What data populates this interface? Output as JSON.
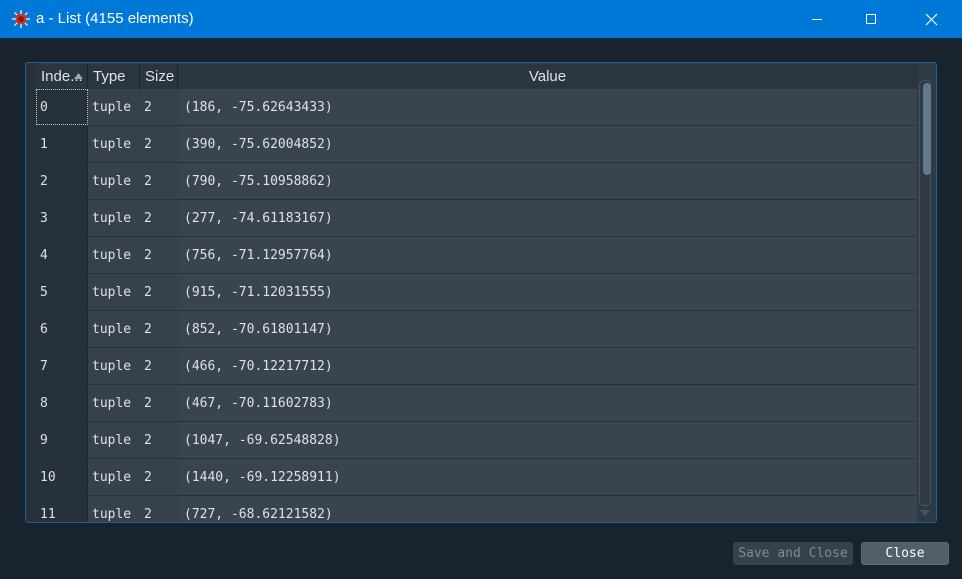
{
  "window": {
    "title": "a - List (4155 elements)",
    "accent_color": "#0078d7",
    "icon": "spyder-icon"
  },
  "table": {
    "columns": [
      "Inde...",
      "Type",
      "Size",
      "Value"
    ],
    "sort_column": "Inde...",
    "rows": [
      {
        "index": "0",
        "type": "tuple",
        "size": "2",
        "value": "(186, -75.62643433)"
      },
      {
        "index": "1",
        "type": "tuple",
        "size": "2",
        "value": "(390, -75.62004852)"
      },
      {
        "index": "2",
        "type": "tuple",
        "size": "2",
        "value": "(790, -75.10958862)"
      },
      {
        "index": "3",
        "type": "tuple",
        "size": "2",
        "value": "(277, -74.61183167)"
      },
      {
        "index": "4",
        "type": "tuple",
        "size": "2",
        "value": "(756, -71.12957764)"
      },
      {
        "index": "5",
        "type": "tuple",
        "size": "2",
        "value": "(915, -71.12031555)"
      },
      {
        "index": "6",
        "type": "tuple",
        "size": "2",
        "value": "(852, -70.61801147)"
      },
      {
        "index": "7",
        "type": "tuple",
        "size": "2",
        "value": "(466, -70.12217712)"
      },
      {
        "index": "8",
        "type": "tuple",
        "size": "2",
        "value": "(467, -70.11602783)"
      },
      {
        "index": "9",
        "type": "tuple",
        "size": "2",
        "value": "(1047, -69.62548828)"
      },
      {
        "index": "10",
        "type": "tuple",
        "size": "2",
        "value": "(1440, -69.12258911)"
      },
      {
        "index": "11",
        "type": "tuple",
        "size": "2",
        "value": "(727, -68.62121582)"
      }
    ]
  },
  "buttons": {
    "save_close": "Save and Close",
    "close": "Close"
  }
}
